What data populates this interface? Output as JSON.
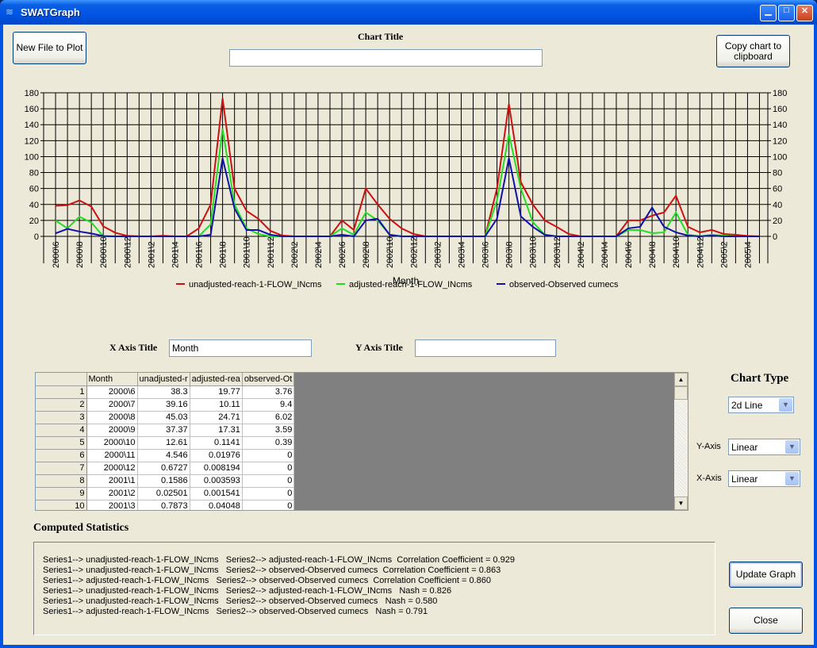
{
  "window": {
    "title": "SWATGraph",
    "minimize": "minimize",
    "maximize": "maximize",
    "close": "close"
  },
  "toolbar": {
    "new_file_label": "New File to Plot",
    "chart_title_label": "Chart Title",
    "chart_title_value": "",
    "copy_label": "Copy chart to clipboard"
  },
  "axis_titles": {
    "x_label": "X Axis Title",
    "x_value": "Month",
    "y_label": "Y Axis Title",
    "y_value": ""
  },
  "chart_type": {
    "label": "Chart Type",
    "value": "2d Line",
    "y_axis_label": "Y-Axis",
    "y_axis_value": "Linear",
    "x_axis_label": "X-Axis",
    "x_axis_value": "Linear"
  },
  "table": {
    "headers": [
      "Month",
      "unadjusted-r",
      "adjusted-rea",
      "observed-Ot"
    ],
    "rows": [
      {
        "n": "1",
        "cells": [
          "2000\\6",
          "38.3",
          "19.77",
          "3.76"
        ]
      },
      {
        "n": "2",
        "cells": [
          "2000\\7",
          "39.16",
          "10.11",
          "9.4"
        ]
      },
      {
        "n": "3",
        "cells": [
          "2000\\8",
          "45.03",
          "24.71",
          "6.02"
        ]
      },
      {
        "n": "4",
        "cells": [
          "2000\\9",
          "37.37",
          "17.31",
          "3.59"
        ]
      },
      {
        "n": "5",
        "cells": [
          "2000\\10",
          "12.61",
          "0.1141",
          "0.39"
        ]
      },
      {
        "n": "6",
        "cells": [
          "2000\\11",
          "4.546",
          "0.01976",
          "0"
        ]
      },
      {
        "n": "7",
        "cells": [
          "2000\\12",
          "0.6727",
          "0.008194",
          "0"
        ]
      },
      {
        "n": "8",
        "cells": [
          "2001\\1",
          "0.1586",
          "0.003593",
          "0"
        ]
      },
      {
        "n": "9",
        "cells": [
          "2001\\2",
          "0.02501",
          "0.001541",
          "0"
        ]
      },
      {
        "n": "10",
        "cells": [
          "2001\\3",
          "0.7873",
          "0.04048",
          "0"
        ]
      }
    ]
  },
  "stats": {
    "title": "Computed Statistics",
    "lines": [
      "Series1--> unadjusted-reach-1-FLOW_INcms   Series2--> adjusted-reach-1-FLOW_INcms  Correlation Coefficient = 0.929",
      "Series1--> unadjusted-reach-1-FLOW_INcms   Series2--> observed-Observed cumecs  Correlation Coefficient = 0.863",
      "Series1--> adjusted-reach-1-FLOW_INcms   Series2--> observed-Observed cumecs  Correlation Coefficient = 0.860",
      "Series1--> unadjusted-reach-1-FLOW_INcms   Series2--> adjusted-reach-1-FLOW_INcms   Nash = 0.826",
      "Series1--> unadjusted-reach-1-FLOW_INcms   Series2--> observed-Observed cumecs   Nash = 0.580",
      "Series1--> adjusted-reach-1-FLOW_INcms   Series2--> observed-Observed cumecs   Nash = 0.791"
    ]
  },
  "buttons": {
    "update": "Update Graph",
    "close": "Close"
  },
  "chart_data": {
    "type": "line",
    "title": "",
    "xlabel": "Month",
    "ylabel": "",
    "ylim": [
      0,
      180
    ],
    "yticks": [
      0,
      20,
      40,
      60,
      80,
      100,
      120,
      140,
      160,
      180
    ],
    "grid": true,
    "legend_position": "bottom",
    "x": [
      "2000\\6",
      "2000\\7",
      "2000\\8",
      "2000\\9",
      "2000\\10",
      "2000\\11",
      "2000\\12",
      "2001\\1",
      "2001\\2",
      "2001\\3",
      "2001\\4",
      "2001\\5",
      "2001\\6",
      "2001\\7",
      "2001\\8",
      "2001\\9",
      "2001\\10",
      "2001\\11",
      "2001\\12",
      "2002\\1",
      "2002\\2",
      "2002\\3",
      "2002\\4",
      "2002\\5",
      "2002\\6",
      "2002\\7",
      "2002\\8",
      "2002\\9",
      "2002\\10",
      "2002\\11",
      "2002\\12",
      "2003\\1",
      "2003\\2",
      "2003\\3",
      "2003\\4",
      "2003\\5",
      "2003\\6",
      "2003\\7",
      "2003\\8",
      "2003\\9",
      "2003\\10",
      "2003\\11",
      "2003\\12",
      "2004\\1",
      "2004\\2",
      "2004\\3",
      "2004\\4",
      "2004\\5",
      "2004\\6",
      "2004\\7",
      "2004\\8",
      "2004\\9",
      "2004\\10",
      "2004\\11",
      "2004\\12",
      "2005\\1",
      "2005\\2",
      "2005\\3",
      "2005\\4",
      "2005\\5"
    ],
    "xtick_labels": [
      "2000\\6",
      "2000\\8",
      "2000\\10",
      "2000\\12",
      "2001\\2",
      "2001\\4",
      "2001\\6",
      "2001\\8",
      "2001\\10",
      "2001\\12",
      "2002\\2",
      "2002\\4",
      "2002\\6",
      "2002\\8",
      "2002\\10",
      "2002\\12",
      "2003\\2",
      "2003\\4",
      "2003\\6",
      "2003\\8",
      "2003\\10",
      "2003\\12",
      "2004\\2",
      "2004\\4",
      "2004\\6",
      "2004\\8",
      "2004\\10",
      "2004\\12",
      "2005\\2",
      "2005\\4"
    ],
    "series": [
      {
        "name": "unadjusted-reach-1-FLOW_INcms",
        "color": "#cc1111",
        "values": [
          38.3,
          39.16,
          45.03,
          37.37,
          12.61,
          4.546,
          0.6727,
          0.1586,
          0.025,
          0.7873,
          0,
          0,
          10,
          40,
          173,
          60,
          32,
          22,
          7,
          1,
          0,
          0,
          0,
          0,
          20,
          8,
          60,
          40,
          22,
          10,
          3,
          0,
          0,
          0,
          0,
          0,
          0,
          60,
          166,
          68,
          40,
          20,
          12,
          3,
          0,
          0,
          0,
          0,
          20,
          20,
          26,
          30,
          51,
          12,
          5,
          8,
          3,
          2,
          0.5,
          0
        ]
      },
      {
        "name": "adjusted-reach-1-FLOW_INcms",
        "color": "#22dd22",
        "values": [
          19.77,
          10.11,
          24.71,
          17.31,
          0.1141,
          0.0198,
          0.0082,
          0.0036,
          0.0015,
          0.0405,
          0,
          0,
          0,
          15,
          135,
          40,
          10,
          3,
          0,
          0,
          0,
          0,
          0,
          0,
          10,
          2,
          30,
          20,
          2,
          0,
          0,
          0,
          0,
          0,
          0,
          0,
          0,
          45,
          128,
          60,
          18,
          2,
          0,
          0,
          0,
          0,
          0,
          0,
          8,
          8,
          4,
          5,
          30,
          2,
          0,
          2,
          1,
          0,
          0,
          0
        ]
      },
      {
        "name": "observed-Observed cumecs",
        "color": "#1111aa",
        "values": [
          3.76,
          9.4,
          6.02,
          3.59,
          0.39,
          0,
          0,
          0,
          0,
          0,
          0,
          0,
          0,
          2,
          98,
          35,
          8,
          8,
          2,
          0,
          0,
          0,
          0,
          0,
          2,
          0,
          20,
          22,
          2,
          0,
          0,
          0,
          0,
          0,
          0,
          0,
          0,
          22,
          98,
          25,
          12,
          2,
          0,
          0,
          0,
          0,
          0,
          0,
          10,
          12,
          36,
          12,
          5,
          1,
          0,
          1,
          0,
          0,
          0,
          0
        ]
      }
    ]
  }
}
